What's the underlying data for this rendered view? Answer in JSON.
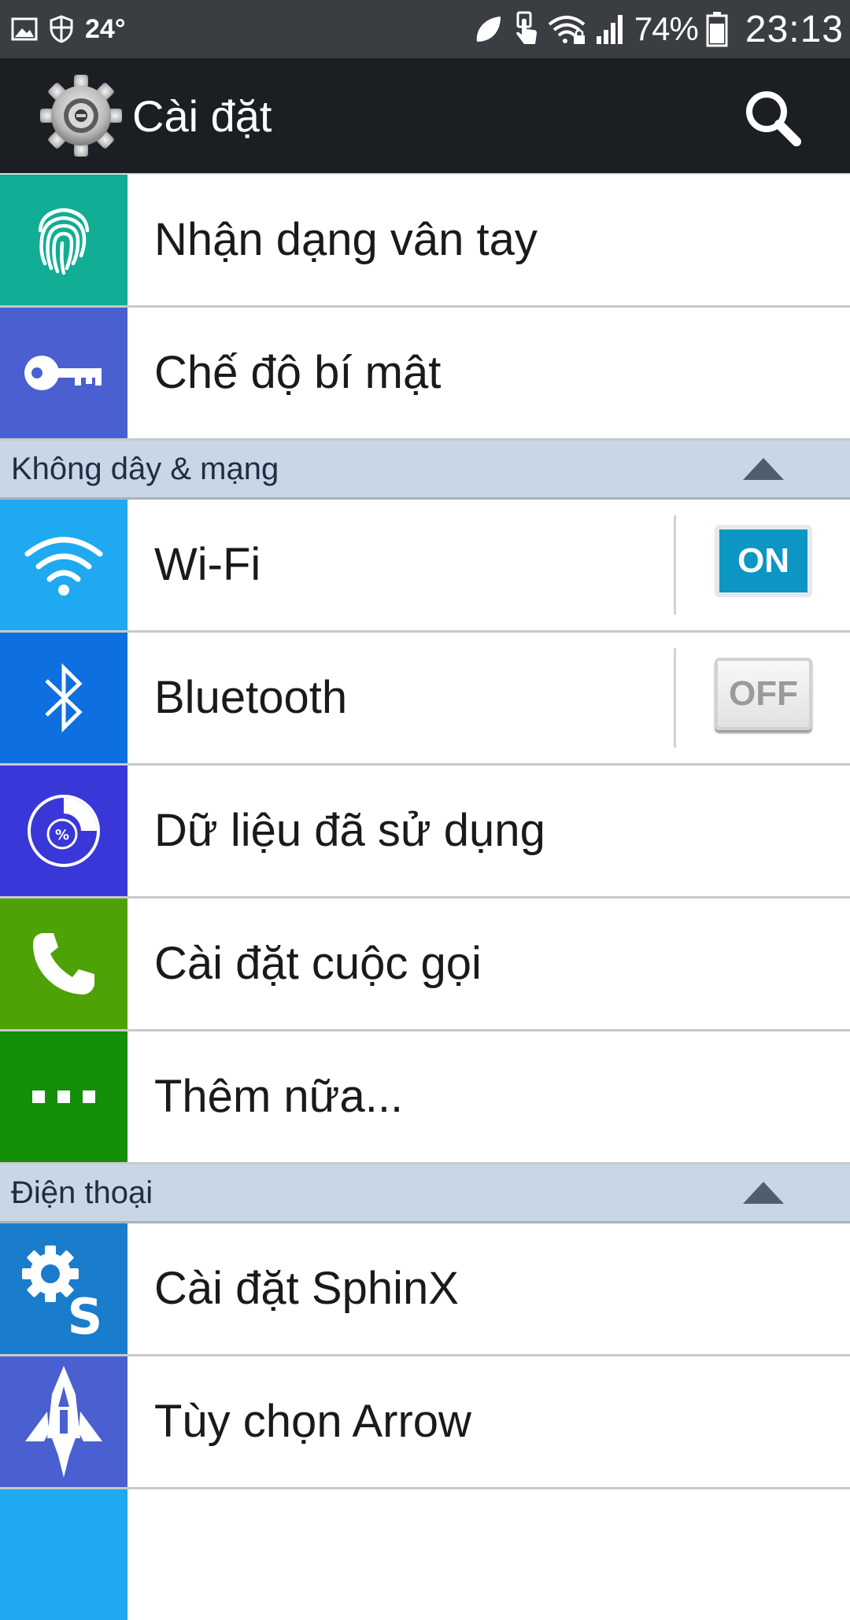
{
  "statusbar": {
    "temperature": "24°",
    "battery_percent": "74%",
    "time": "23:13",
    "icons_left": [
      "gallery-icon",
      "shield-icon"
    ],
    "icons_right": [
      "leaf-icon",
      "touch-icon",
      "wifi-lock-icon",
      "signal-icon",
      "battery-icon"
    ]
  },
  "actionbar": {
    "title": "Cài đặt",
    "icon": "settings-gear-icon",
    "search_icon": "search-icon"
  },
  "rows": [
    {
      "label": "Nhận dạng vân tay",
      "icon": "fingerprint-icon",
      "color": "#11ad94"
    },
    {
      "label": "Chế độ bí mật",
      "icon": "key-icon",
      "color": "#4a5fd0"
    }
  ],
  "sections": [
    {
      "title": "Không dây & mạng",
      "items": [
        {
          "label": "Wi-Fi",
          "icon": "wifi-icon",
          "color": "#1fa9f1",
          "toggle": "ON"
        },
        {
          "label": "Bluetooth",
          "icon": "bluetooth-icon",
          "color": "#0e6fe0",
          "toggle": "OFF"
        },
        {
          "label": "Dữ liệu đã sử dụng",
          "icon": "data-usage-icon",
          "color": "#3a37d8"
        },
        {
          "label": "Cài đặt cuộc gọi",
          "icon": "phone-icon",
          "color": "#4ea207"
        },
        {
          "label": "Thêm nữa...",
          "icon": "more-dots-icon",
          "color": "#158e0a"
        }
      ]
    },
    {
      "title": "Điện thoại",
      "items": [
        {
          "label": "Cài đặt SphinX",
          "icon": "sphinx-gear-icon",
          "color": "#1a7ccc"
        },
        {
          "label": "Tùy chọn Arrow",
          "icon": "arrow-rocket-icon",
          "color": "#4a5fd0"
        }
      ]
    }
  ],
  "partial_next_row_color": "#1fa9f1"
}
